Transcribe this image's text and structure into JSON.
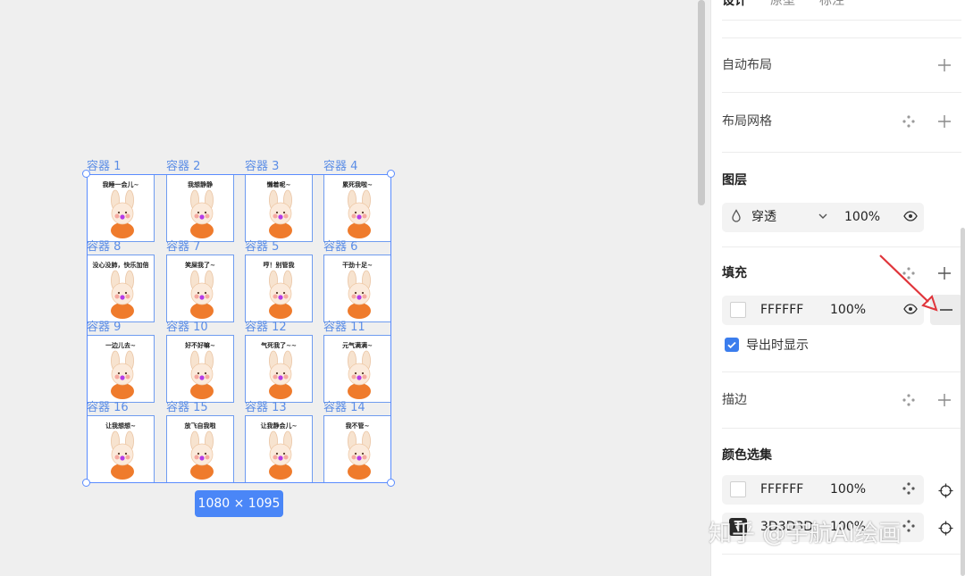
{
  "panel": {
    "tabs": [
      "设计",
      "原型",
      "标注"
    ],
    "auto_layout": {
      "title": "自动布局"
    },
    "layout_grid": {
      "title": "布局网格"
    },
    "layer": {
      "title": "图层",
      "blend_mode": "穿透",
      "opacity": "100%"
    },
    "fill": {
      "title": "填充",
      "hex": "FFFFFF",
      "opacity": "100%",
      "show_on_export": "导出时显示"
    },
    "stroke": {
      "title": "描边"
    },
    "color_selection": {
      "title": "颜色选集",
      "items": [
        {
          "hex": "FFFFFF",
          "opacity": "100%"
        },
        {
          "hex": "3D3D3D",
          "opacity": "100%"
        }
      ]
    }
  },
  "canvas": {
    "dimensions_badge": "1080 × 1095",
    "cells": [
      {
        "label": "容器 1",
        "caption": "我睡一会儿~"
      },
      {
        "label": "容器 2",
        "caption": "我想静静"
      },
      {
        "label": "容器 3",
        "caption": "懒着呢~"
      },
      {
        "label": "容器 4",
        "caption": "累死我啦~"
      },
      {
        "label": "容器 8",
        "caption": "没心没肺，快乐加倍"
      },
      {
        "label": "容器 7",
        "caption": "笑屎我了~"
      },
      {
        "label": "容器 5",
        "caption": "哼！别管我"
      },
      {
        "label": "容器 6",
        "caption": "干劲十足~"
      },
      {
        "label": "容器 9",
        "caption": "一边儿去~"
      },
      {
        "label": "容器 10",
        "caption": "好不好嘛~"
      },
      {
        "label": "容器 12",
        "caption": "气死我了~~"
      },
      {
        "label": "容器 11",
        "caption": "元气满满~"
      },
      {
        "label": "容器 16",
        "caption": "让我想想~"
      },
      {
        "label": "容器 15",
        "caption": "放飞自我啦"
      },
      {
        "label": "容器 13",
        "caption": "让我静会儿~"
      },
      {
        "label": "容器 14",
        "caption": "我不管~"
      }
    ]
  },
  "watermark": "知乎 @宇航AI绘画",
  "colors": {
    "selection": "#5a8cff",
    "badge": "#4a86f7",
    "annotation_arrow": "#e0353b",
    "checkbox": "#3b7ded"
  }
}
